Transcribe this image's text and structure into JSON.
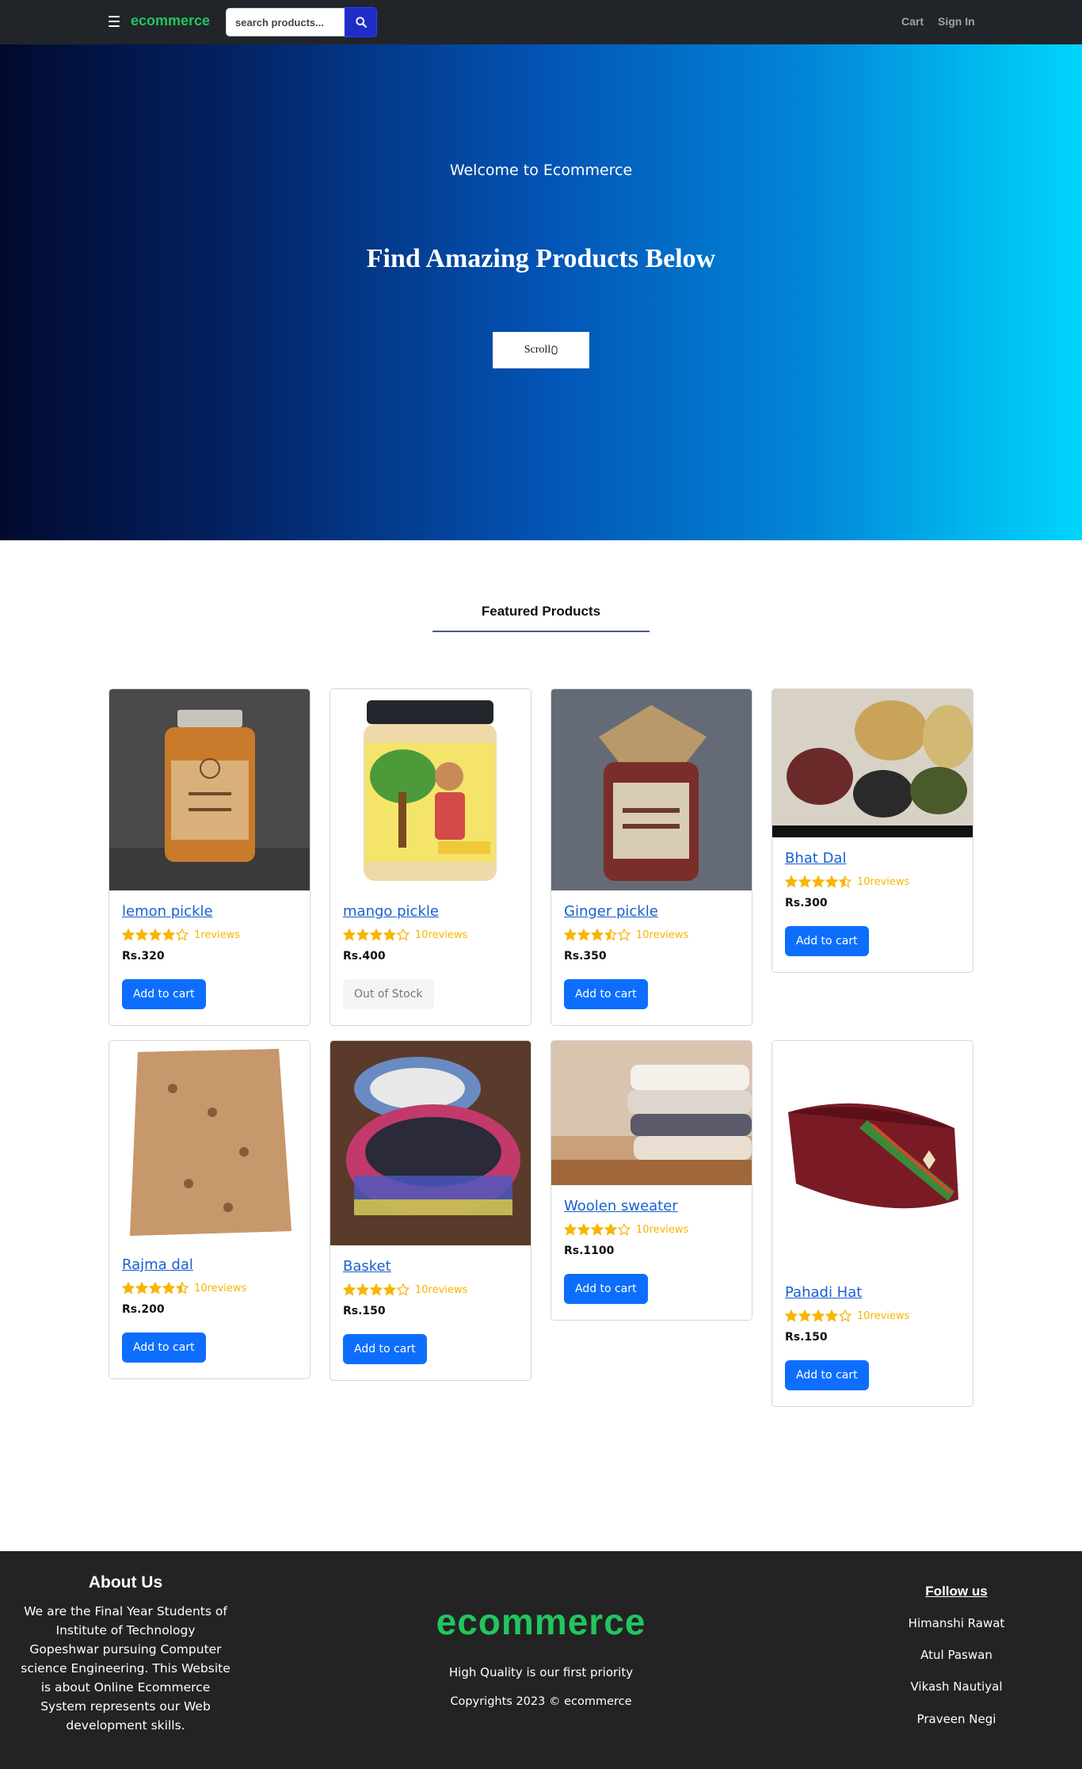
{
  "navbar": {
    "brand": "ecommerce",
    "search_placeholder": "search products...",
    "links": [
      "Cart",
      "Sign In"
    ]
  },
  "hero": {
    "welcome": "Welcome to Ecommerce",
    "heading": "Find Amazing Products Below",
    "scroll_label": "Scroll"
  },
  "featured": {
    "heading": "Featured Products"
  },
  "products": [
    {
      "name": "lemon pickle",
      "rating": 4,
      "reviews": "1reviews",
      "price": "Rs.320",
      "button": "Add to cart",
      "in_stock": true
    },
    {
      "name": "mango pickle",
      "rating": 4,
      "reviews": "10reviews",
      "price": "Rs.400",
      "button": "Out of Stock",
      "in_stock": false
    },
    {
      "name": "Ginger pickle",
      "rating": 3.5,
      "reviews": "10reviews",
      "price": "Rs.350",
      "button": "Add to cart",
      "in_stock": true
    },
    {
      "name": "Bhat Dal",
      "rating": 4.5,
      "reviews": "10reviews",
      "price": "Rs.300",
      "button": "Add to cart",
      "in_stock": true
    },
    {
      "name": "Rajma dal",
      "rating": 4.5,
      "reviews": "10reviews",
      "price": "Rs.200",
      "button": "Add to cart",
      "in_stock": true
    },
    {
      "name": "Basket",
      "rating": 4,
      "reviews": "10reviews",
      "price": "Rs.150",
      "button": "Add to cart",
      "in_stock": true
    },
    {
      "name": "Woolen sweater",
      "rating": 4,
      "reviews": "10reviews",
      "price": "Rs.1100",
      "button": "Add to cart",
      "in_stock": true
    },
    {
      "name": "Pahadi Hat",
      "rating": 4,
      "reviews": "10reviews",
      "price": "Rs.150",
      "button": "Add to cart",
      "in_stock": true
    }
  ],
  "footer": {
    "about_title": "About Us",
    "about_text": "We are the Final Year Students of Institute of Technology Gopeshwar pursuing Computer science Engineering. This Website is about Online Ecommerce System represents our Web development skills.",
    "brand": "ecommerce",
    "tagline": "High Quality is our first priority",
    "copyright": "Copyrights 2023 © ecommerce",
    "follow_title": "Follow us",
    "follow_links": [
      "Himanshi Rawat",
      "Atul Paswan",
      "Vikash Nautiyal",
      "Praveen Negi"
    ]
  },
  "colors": {
    "brand_green": "#22c55e",
    "navbar_bg": "#212529",
    "primary_button": "#0d6efd",
    "link_blue": "#1a5fd0",
    "star_yellow": "#f7b500",
    "footer_bg": "#232323"
  },
  "icons": {
    "menu": "hamburger-menu-icon",
    "search": "magnifier-search-icon",
    "star": "star-rating-icon"
  }
}
